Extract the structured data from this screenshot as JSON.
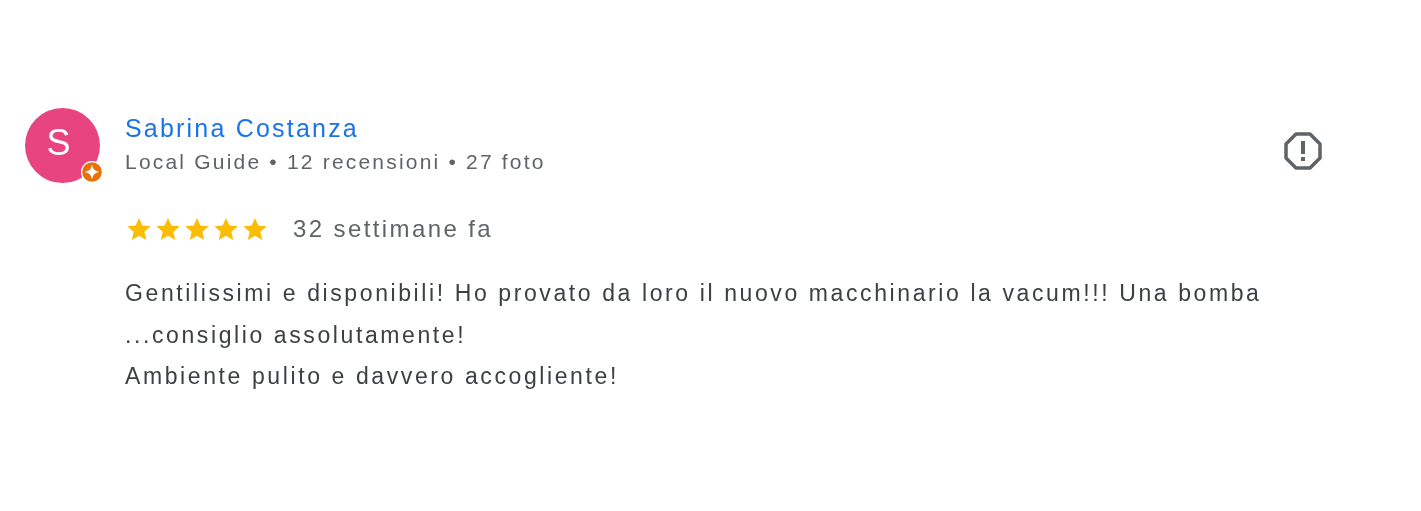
{
  "review": {
    "avatar_letter": "S",
    "author": "Sabrina Costanza",
    "local_guide": true,
    "meta": "Local Guide • 12 recensioni • 27 foto",
    "stars": 5,
    "time": "32 settimane fa",
    "body": [
      "Gentilissimi e disponibili! Ho provato da loro il nuovo macchinario la vacum!!! Una bomba",
      "...consiglio assolutamente!",
      "Ambiente pulito e davvero accogliente!"
    ]
  }
}
